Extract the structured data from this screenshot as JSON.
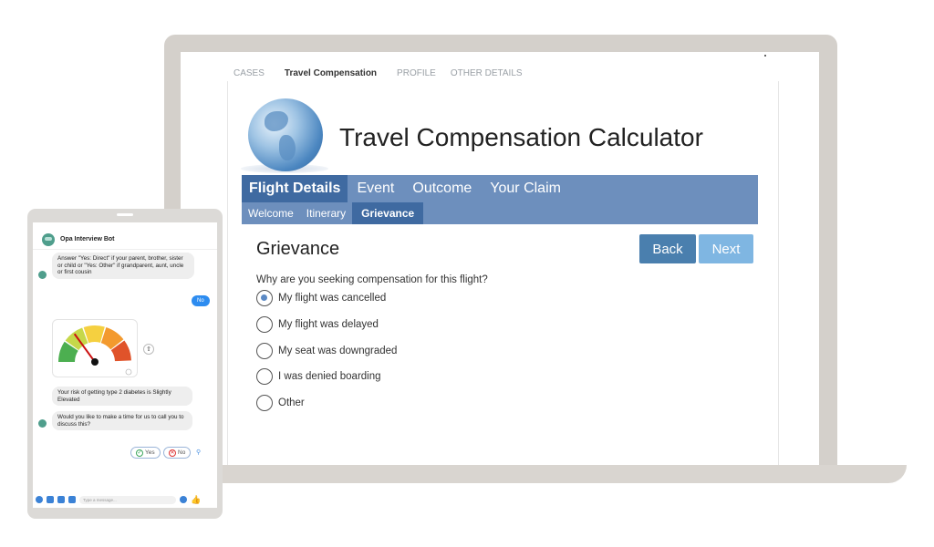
{
  "laptop": {
    "tabs": [
      "CASES",
      "Travel Compensation",
      "PROFILE",
      "OTHER DETAILS"
    ],
    "active_tab_index": 1,
    "app": {
      "title": "Travel Compensation Calculator",
      "nav_main": [
        "Flight Details",
        "Event",
        "Outcome",
        "Your Claim"
      ],
      "nav_sub": [
        "Welcome",
        "Itinerary",
        "Grievance"
      ],
      "section_title": "Grievance",
      "back_label": "Back",
      "next_label": "Next",
      "question": "Why are you seeking compensation for this flight?",
      "options": [
        "My flight was cancelled",
        "My flight was delayed",
        "My seat was downgraded",
        "I was denied boarding",
        "Other"
      ],
      "selected_option": "My flight was cancelled"
    },
    "colors": {
      "nav": "#6d8fbd",
      "nav_active": "#3f6aa1",
      "back": "#4a7fae",
      "next": "#7fb6e2"
    }
  },
  "chatbot": {
    "name": "Opa Interview Bot",
    "messages": {
      "bot_prompt": "Answer \"Yes: Direct\" if your parent, brother, sister or child or \"Yes: Other\" if grandparent, aunt, uncle or first cousin",
      "user_reply": "No",
      "risk_result": "Your risk of getting type 2 diabetes is Slightly Elevated",
      "call_question": "Would you like to make a time for us to call you to discuss this?"
    },
    "gauge": {
      "level": 0.3,
      "segments": [
        "#4caf50",
        "#c6d84a",
        "#f5d040",
        "#f39a2e",
        "#e0532a"
      ]
    },
    "chips": [
      "Yes",
      "No"
    ],
    "composer_placeholder": "Type a message..."
  }
}
